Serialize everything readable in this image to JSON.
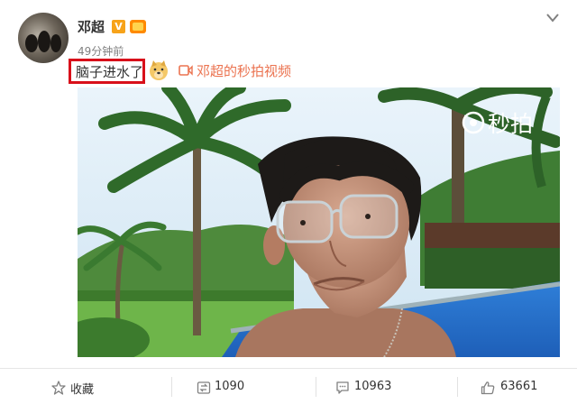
{
  "post": {
    "username": "邓超",
    "verified_badge": "V",
    "time": "49分钟前",
    "text": "脑子进水了",
    "emoji_icon": "doge-emoji-icon",
    "video_link": "邓超的秒拍视频",
    "watermark": "秒拍",
    "colors": {
      "link": "#eb7350",
      "highlight_box": "#d8101a",
      "verified": "#f7a31a"
    }
  },
  "actions": {
    "favorite": {
      "icon": "star-icon",
      "label": "收藏"
    },
    "repost": {
      "icon": "repost-icon",
      "count": "1090"
    },
    "comment": {
      "icon": "comment-icon",
      "count": "10963"
    },
    "like": {
      "icon": "thumbs-up-icon",
      "count": "63661"
    }
  }
}
